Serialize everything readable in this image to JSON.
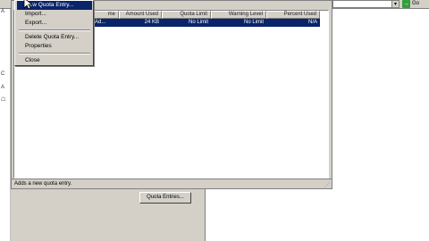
{
  "address_bar": {
    "go_label": "Go"
  },
  "menu": {
    "items": [
      {
        "label": "New Quota Entry...",
        "selected": true
      },
      {
        "label": "Import..."
      },
      {
        "label": "Export..."
      },
      {
        "separator": true
      },
      {
        "label": "Delete Quota Entry..."
      },
      {
        "label": "Properties"
      },
      {
        "separator": true
      },
      {
        "label": "Close"
      }
    ]
  },
  "table": {
    "columns": [
      "me",
      "Amount Used",
      "Quota Limit",
      "Warning Level",
      "Percent Used"
    ],
    "rows": [
      {
        "name": "Ad...",
        "amount_used": "24 KB",
        "quota_limit": "No Limit",
        "warning_level": "No Limit",
        "percent_used": "N/A"
      }
    ]
  },
  "status_bar": {
    "text": "Adds a new quota entry."
  },
  "quota_entries_button": {
    "label": "Quota Entries..."
  },
  "colors": {
    "selection": "#0a246a",
    "window": "#d4d0c8"
  }
}
